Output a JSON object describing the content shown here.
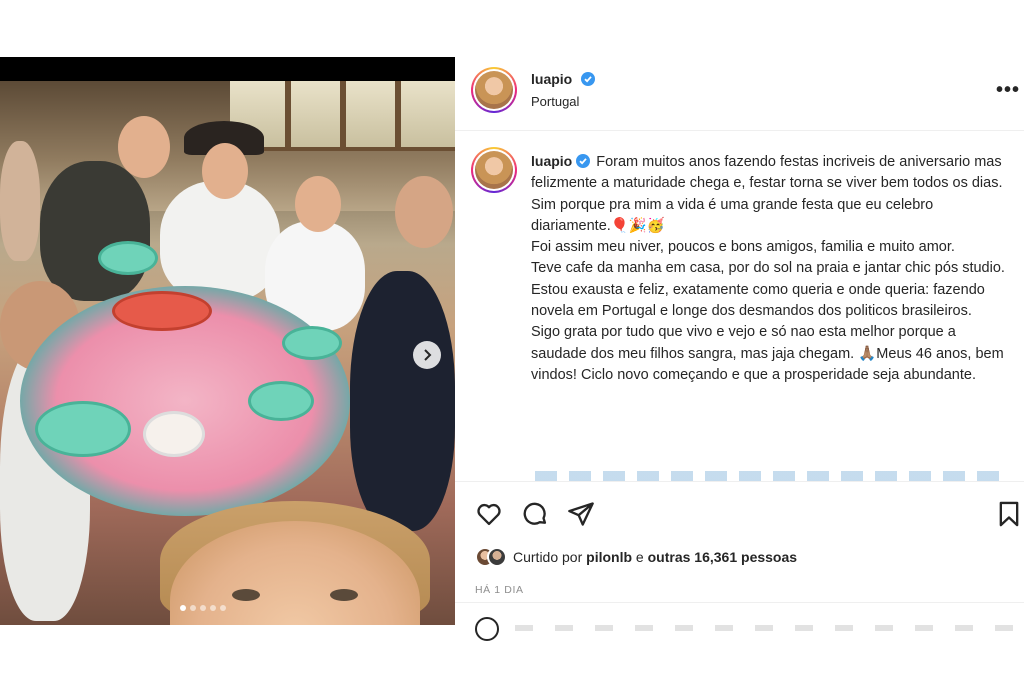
{
  "post": {
    "username": "luapio",
    "location": "Portugal",
    "more_label": "•••"
  },
  "caption": {
    "username": "luapio",
    "paragraphs": [
      "Foram muitos anos fazendo festas incriveis de aniversario mas felizmente a maturidade chega e, festar torna se viver bem todos os dias. Sim porque pra mim a vida é uma grande festa que eu celebro diariamente.🎈🎉🥳",
      "Foi assim meu niver, poucos e bons amigos, familia e muito amor.",
      "Teve cafe da manha em casa, por do sol na praia e jantar chic pós studio.",
      "Estou exausta e feliz, exatamente como queria e onde queria: fazendo novela em Portugal e longe dos desmandos dos politicos brasileiros.",
      "Sigo grata por tudo que vivo e vejo e só nao esta melhor porque a saudade dos meu filhos sangra, mas jaja chegam. 🙏🏽Meus 46 anos, bem vindos! Ciclo novo começando e que a prosperidade seja abundante."
    ]
  },
  "likes": {
    "prefix": "Curtido por ",
    "user": "pilonlb",
    "middle": " e ",
    "others": "outras 16,361 pessoas"
  },
  "time_ago": "HÁ 1 DIA",
  "carousel": {
    "slide_count": 5,
    "active_index": 0
  },
  "colors": {
    "verified": "#3897f0",
    "text": "#262626",
    "secondary": "#8e8e8e"
  },
  "icons": [
    "heart-icon",
    "comment-icon",
    "share-icon",
    "bookmark-icon",
    "next-arrow-icon",
    "verified-badge-icon"
  ]
}
